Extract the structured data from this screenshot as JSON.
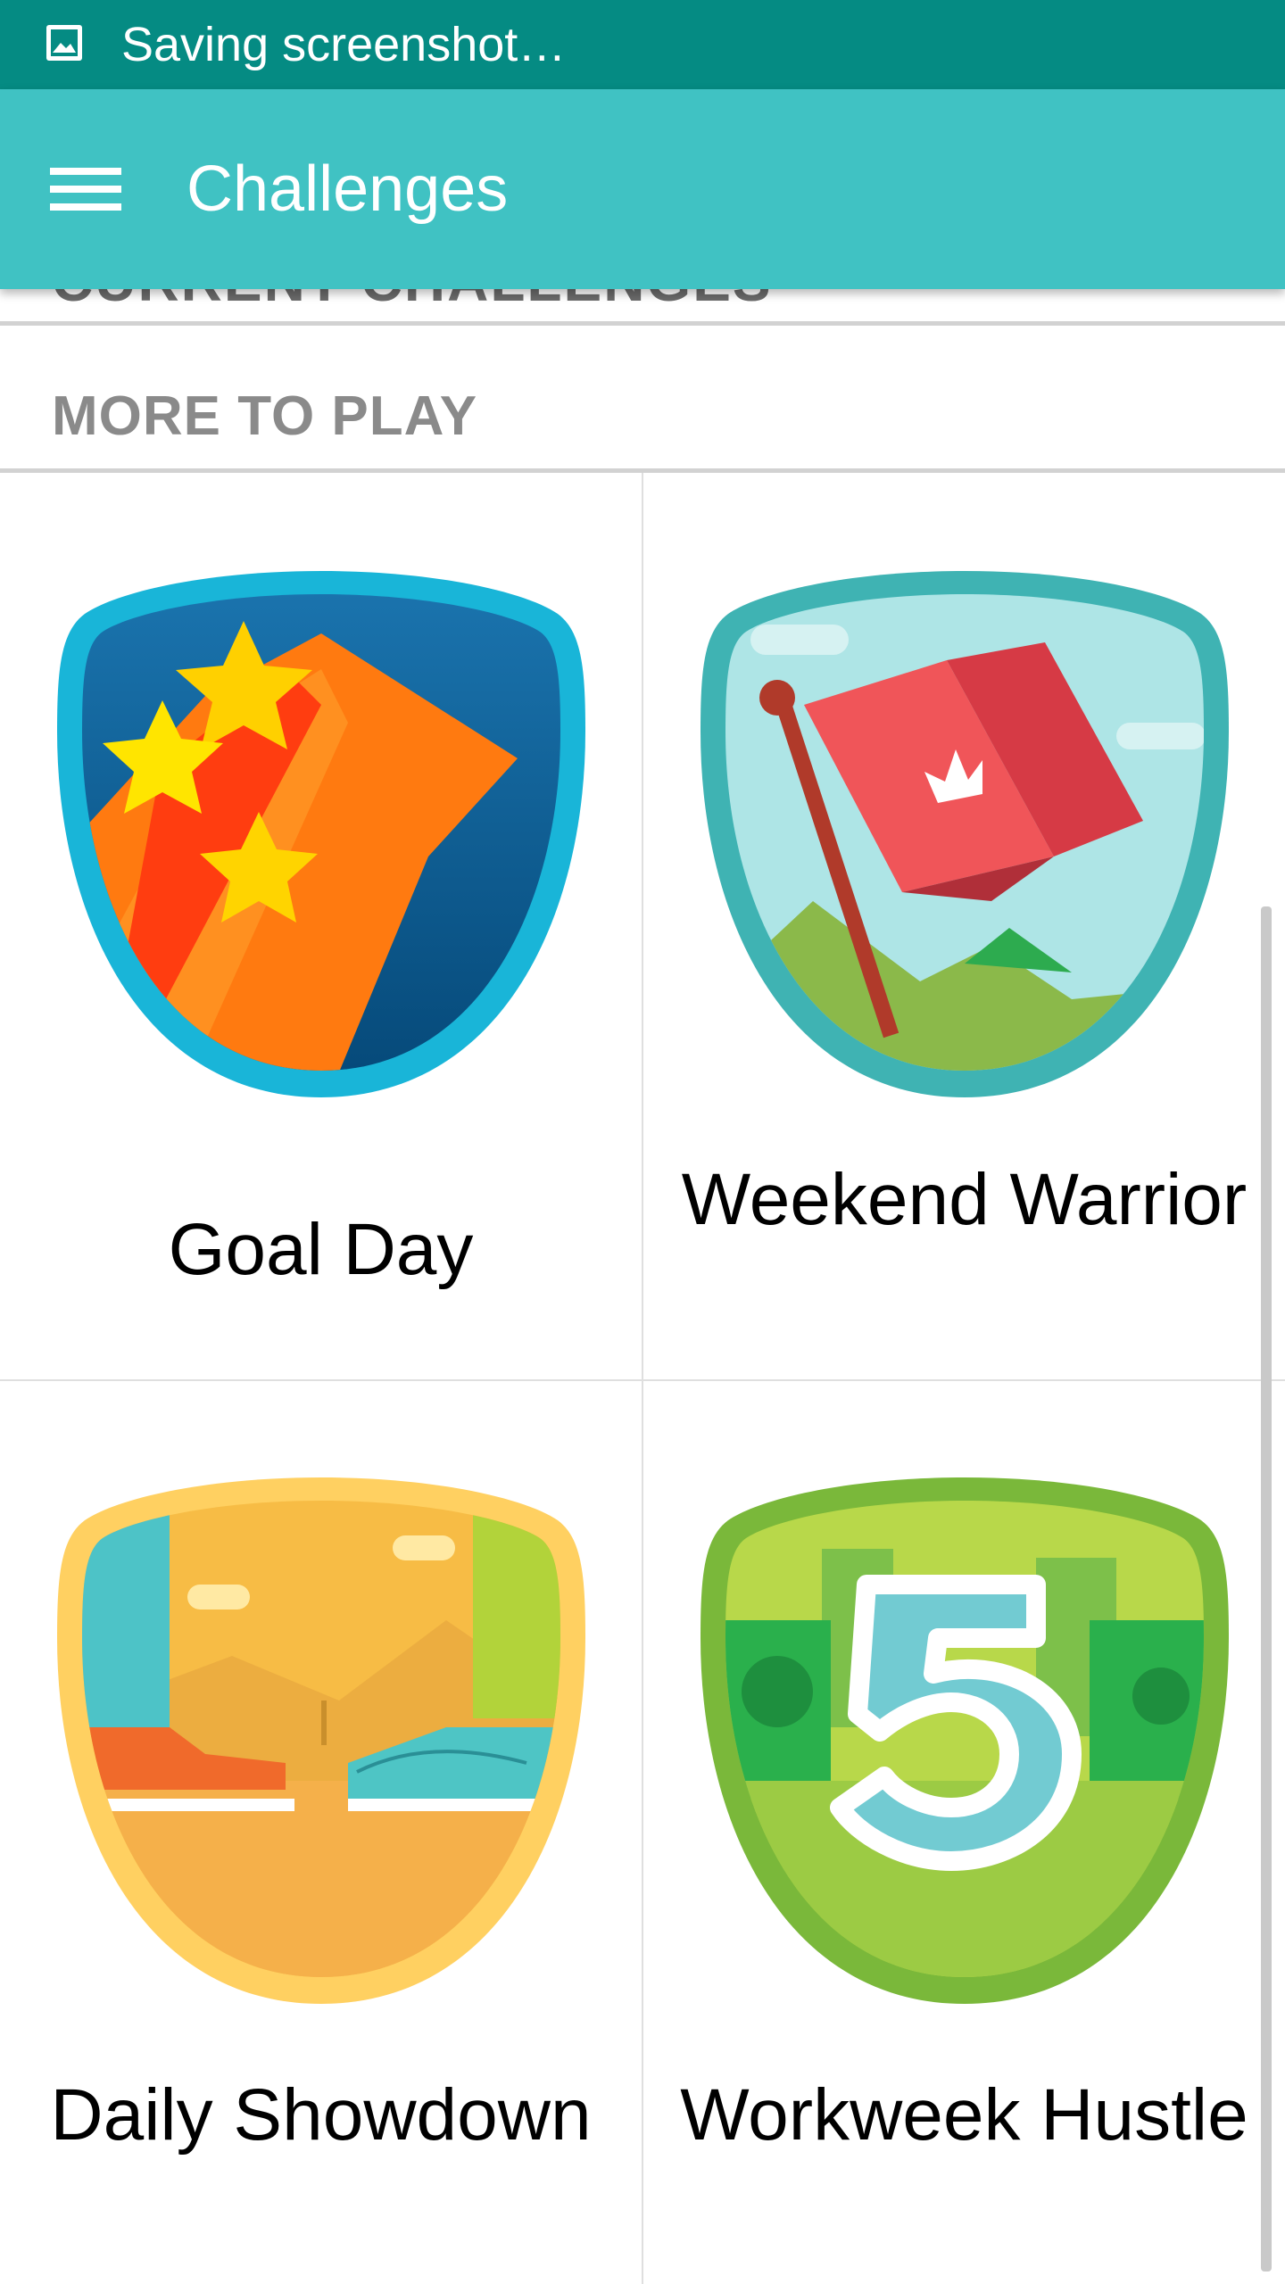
{
  "status_bar": {
    "icon": "image-icon",
    "text": "Saving screenshot…"
  },
  "app_bar": {
    "menu_icon": "hamburger-menu-icon",
    "title": "Challenges"
  },
  "sections": {
    "current_peek": "CURRENT CHALLENGES",
    "more_header": "MORE TO PLAY"
  },
  "challenges": [
    {
      "label": "Goal Day",
      "badge_icon": "goal-day-badge-icon"
    },
    {
      "label": "Weekend Warrior",
      "badge_icon": "weekend-warrior-badge-icon"
    },
    {
      "label": "Daily Showdown",
      "badge_icon": "daily-showdown-badge-icon"
    },
    {
      "label": "Workweek Hustle",
      "badge_icon": "workweek-hustle-badge-icon"
    }
  ],
  "colors": {
    "status_bar": "#058b83",
    "app_bar": "#40c2c3"
  }
}
